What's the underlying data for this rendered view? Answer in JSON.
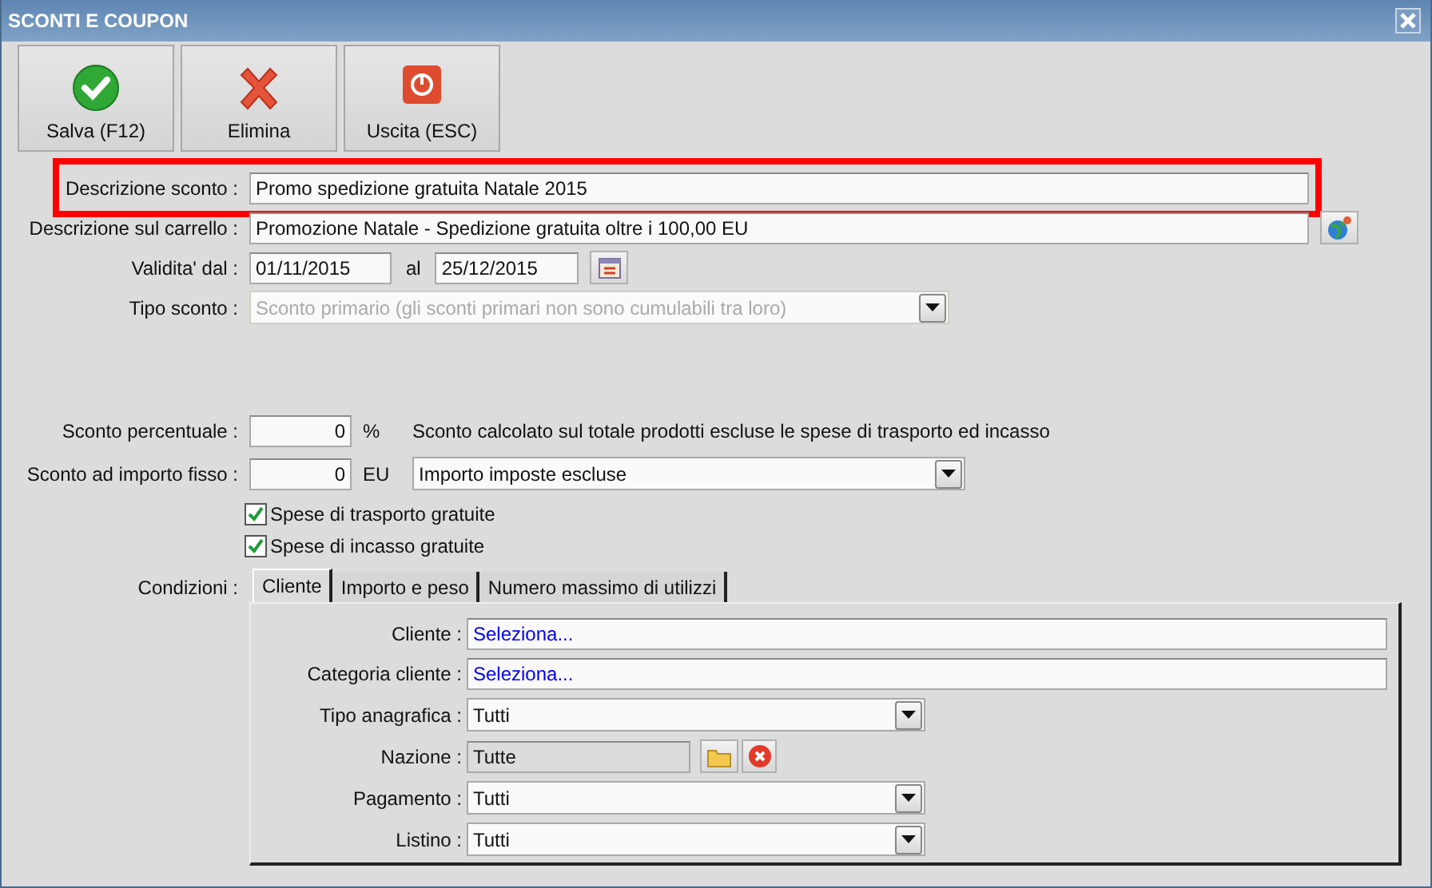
{
  "window": {
    "title": "SCONTI E COUPON"
  },
  "toolbar": [
    {
      "kind": "save",
      "label": "Salva (F12)"
    },
    {
      "kind": "delete",
      "label": "Elimina"
    },
    {
      "kind": "exit",
      "label": "Uscita (ESC)"
    }
  ],
  "description": {
    "label": "Descrizione sconto :",
    "value": "Promo spedizione gratuita Natale 2015",
    "highlighted": true
  },
  "cart_description": {
    "label": "Descrizione sul carrello :",
    "value": "Promozione Natale - Spedizione gratuita oltre i 100,00 EU"
  },
  "validity": {
    "label": "Validita' dal :",
    "from": "01/11/2015",
    "to_label": "al",
    "to": "25/12/2015"
  },
  "discount_type": {
    "label": "Tipo sconto :",
    "value": "Sconto primario (gli sconti primari non sono cumulabili tra loro)",
    "disabled": true
  },
  "percent": {
    "label": "Sconto percentuale :",
    "value": "0",
    "unit": "%",
    "note": "Sconto calcolato sul totale prodotti escluse le spese di trasporto ed incasso"
  },
  "fixed": {
    "label": "Sconto ad importo fisso :",
    "value": "0",
    "unit": "EU",
    "mode": "Importo imposte escluse"
  },
  "checkboxes": [
    {
      "label": "Spese di trasporto gratuite",
      "checked": true
    },
    {
      "label": "Spese di incasso gratuite",
      "checked": true
    }
  ],
  "conditions": {
    "label": "Condizioni :",
    "tabs": [
      {
        "label": "Cliente",
        "selected": true
      },
      {
        "label": "Importo e peso",
        "selected": false
      },
      {
        "label": "Numero massimo di utilizzi",
        "selected": false
      }
    ],
    "rows": [
      {
        "kind": "link",
        "label": "Cliente :",
        "value": "Seleziona..."
      },
      {
        "kind": "link",
        "label": "Categoria cliente :",
        "value": "Seleziona..."
      },
      {
        "kind": "select",
        "label": "Tipo anagrafica :",
        "value": "Tutti"
      },
      {
        "kind": "picker",
        "label": "Nazione :",
        "value": "Tutte"
      },
      {
        "kind": "select",
        "label": "Pagamento :",
        "value": "Tutti"
      },
      {
        "kind": "select",
        "label": "Listino :",
        "value": "Tutti"
      }
    ]
  }
}
